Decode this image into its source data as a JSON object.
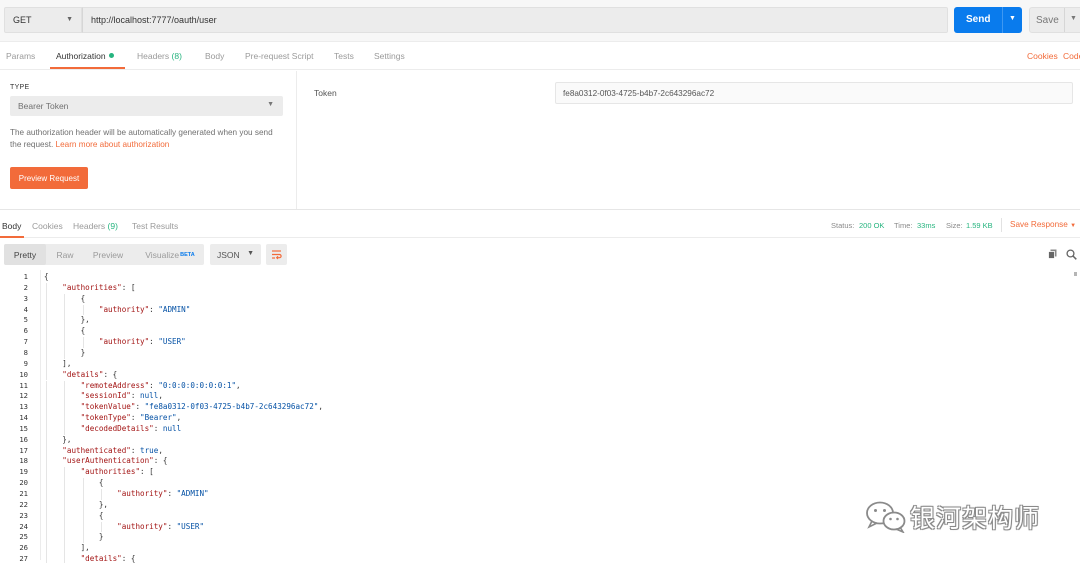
{
  "request": {
    "method": "GET",
    "url": "http://localhost:7777/oauth/user",
    "send_label": "Send",
    "save_label": "Save"
  },
  "req_tabs": {
    "params": "Params",
    "authorization": "Authorization",
    "headers": "Headers",
    "headers_count": "(8)",
    "body": "Body",
    "prerequest": "Pre-request Script",
    "tests": "Tests",
    "settings": "Settings",
    "cookies": "Cookies",
    "code": "Code"
  },
  "auth": {
    "type_label": "TYPE",
    "type_value": "Bearer Token",
    "description": "The authorization header will be automatically generated when you send the request.",
    "learn_more": "Learn more about authorization",
    "preview_button": "Preview Request",
    "token_label": "Token",
    "token_value": "fe8a0312-0f03-4725-b4b7-2c643296ac72"
  },
  "response": {
    "tabs": {
      "body": "Body",
      "cookies": "Cookies",
      "headers": "Headers",
      "headers_count": "(9)",
      "test_results": "Test Results"
    },
    "status_label": "Status:",
    "status_value": "200 OK",
    "time_label": "Time:",
    "time_value": "33ms",
    "size_label": "Size:",
    "size_value": "1.59 KB",
    "save_response": "Save Response"
  },
  "format_bar": {
    "pretty": "Pretty",
    "raw": "Raw",
    "preview": "Preview",
    "visualize": "Visualize",
    "beta": "BETA",
    "format": "JSON"
  },
  "code_lines": [
    "{",
    "    \"authorities\": [",
    "        {",
    "            \"authority\": \"ADMIN\"",
    "        },",
    "        {",
    "            \"authority\": \"USER\"",
    "        }",
    "    ],",
    "    \"details\": {",
    "        \"remoteAddress\": \"0:0:0:0:0:0:0:1\",",
    "        \"sessionId\": null,",
    "        \"tokenValue\": \"fe8a0312-0f03-4725-b4b7-2c643296ac72\",",
    "        \"tokenType\": \"Bearer\",",
    "        \"decodedDetails\": null",
    "    },",
    "    \"authenticated\": true,",
    "    \"userAuthentication\": {",
    "        \"authorities\": [",
    "            {",
    "                \"authority\": \"ADMIN\"",
    "            },",
    "            {",
    "                \"authority\": \"USER\"",
    "            }",
    "        ],",
    "        \"details\": {"
  ],
  "watermark": "银河架构师",
  "colors": {
    "accent": "#f26b3a",
    "send": "#097bed",
    "success": "#26b47f"
  }
}
